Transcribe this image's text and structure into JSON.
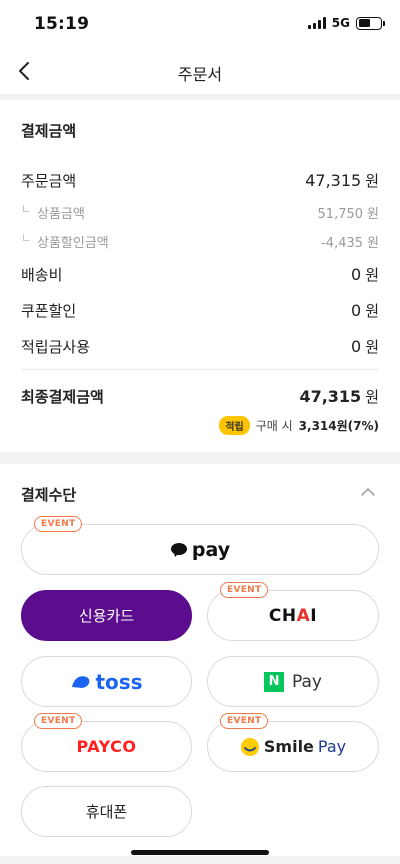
{
  "status_bar": {
    "time": "15:19",
    "network": "5G"
  },
  "nav": {
    "title": "주문서"
  },
  "payment_amount": {
    "title": "결제금액",
    "unit": "원",
    "order_amount": {
      "label": "주문금액",
      "value": "47,315"
    },
    "product_amount": {
      "label": "상품금액",
      "value": "51,750"
    },
    "product_discount": {
      "label": "상품할인금액",
      "value": "-4,435"
    },
    "shipping": {
      "label": "배송비",
      "value": "0"
    },
    "coupon": {
      "label": "쿠폰할인",
      "value": "0"
    },
    "points_used": {
      "label": "적립금사용",
      "value": "0"
    },
    "final": {
      "label": "최종결제금액",
      "value": "47,315"
    },
    "points_earn": {
      "badge": "적립",
      "text": "구매 시",
      "value": "3,314원(7%)"
    }
  },
  "payment_methods": {
    "title": "결제수단",
    "event_tag": "EVENT",
    "kakaopay": {
      "label": "pay"
    },
    "credit_card": {
      "label": "신용카드"
    },
    "chai": {
      "label_a": "CH",
      "label_b": "A",
      "label_c": "I"
    },
    "toss": {
      "label": "toss"
    },
    "naverpay": {
      "badge": "N",
      "label": "Pay"
    },
    "payco": {
      "label": "PAYCO"
    },
    "smilepay": {
      "label_a": "Smile",
      "label_b": "Pay"
    },
    "phone": {
      "label": "휴대폰"
    }
  },
  "colors": {
    "selected": "#5b0d8e",
    "event": "#f07a4a",
    "points_badge": "#ffc400"
  }
}
